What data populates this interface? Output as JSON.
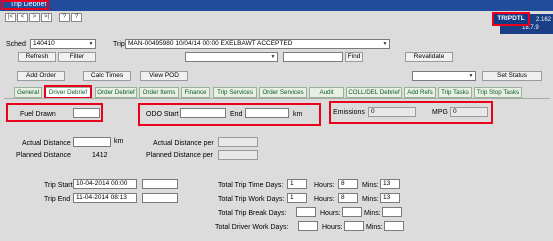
{
  "window": {
    "title": "Trip Debrief",
    "version_line1": "2.162",
    "version_line2": "18.7.9",
    "screen_code": "TRIPDTL"
  },
  "nav": {
    "first": "|<",
    "prev": "<",
    "next": ">",
    "last": ">|",
    "help": "?",
    "query": "?"
  },
  "header": {
    "sched_label": "Sched",
    "sched_value": "140410",
    "trip_label": "Trip",
    "trip_value": "MAN-00495980  10/04/14 00:00  EXELBAWT ACCEPTED",
    "refresh": "Refresh",
    "filter": "Filter",
    "find": "Find",
    "revalidate": "Revalidate"
  },
  "toolbar": {
    "add_order": "Add Order",
    "calc_times": "Calc Times",
    "view_pod": "View POD",
    "set_status": "Set Status"
  },
  "tabs": [
    "General",
    "Driver Debrief",
    "Order Debrief",
    "Order Items",
    "Finance",
    "Trip Services",
    "Order Services",
    "Audit",
    "COLL/DEL Debrief",
    "Add Refs",
    "Trip Tasks",
    "Trip Stop Tasks"
  ],
  "debrief": {
    "fuel_drawn_label": "Fuel Drawn",
    "fuel_drawn_value": "",
    "odo_start_label": "ODO Start",
    "odo_start_value": "",
    "odo_end_label": "End",
    "odo_end_value": "",
    "odo_unit": "km",
    "emissions_label": "Emissions",
    "emissions_value": "0",
    "mpg_label": "MPG",
    "mpg_value": "0",
    "actual_distance_label": "Actual Distance",
    "actual_distance_value": "",
    "actual_distance_unit": "km",
    "planned_distance_label": "Planned Distance",
    "planned_distance_value": "1412",
    "actual_distance_per_label": "Actual Distance per",
    "actual_distance_per_value": "",
    "planned_distance_per_label": "Planned Distance per",
    "planned_distance_per_value": "",
    "trip_start_label": "Trip Start",
    "trip_start_value": "10-04-2014 00:00",
    "trip_end_label": "Trip End",
    "trip_end_value": "11-04-2014 08:13"
  },
  "times": {
    "days_label": "Days:",
    "hours_label": "Hours:",
    "mins_label": "Mins:",
    "rows": [
      {
        "label": "Total Trip Time",
        "days": "1",
        "hours": "8",
        "mins": "13"
      },
      {
        "label": "Total Trip Work",
        "days": "1",
        "hours": "8",
        "mins": "13"
      },
      {
        "label": "Total Trip Break",
        "days": "",
        "hours": "",
        "mins": ""
      },
      {
        "label": "Total Driver Work",
        "days": "",
        "hours": "",
        "mins": ""
      }
    ]
  }
}
